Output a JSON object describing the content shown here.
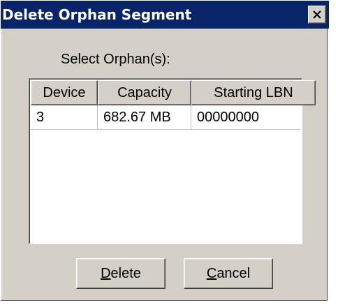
{
  "dialog": {
    "title": "Delete Orphan Segment",
    "close_icon": "close-icon",
    "prompt": "Select Orphan(s):"
  },
  "table": {
    "columns": [
      "Device",
      "Capacity",
      "Starting LBN"
    ],
    "rows": [
      {
        "device": "3",
        "capacity": "682.67 MB",
        "starting_lbn": "00000000"
      }
    ]
  },
  "buttons": {
    "delete": {
      "mnemonic": "D",
      "rest": "elete"
    },
    "cancel": {
      "mnemonic": "C",
      "rest": "ancel"
    }
  },
  "colors": {
    "titlebar": "#0a246a",
    "face": "#d4d0c8"
  }
}
